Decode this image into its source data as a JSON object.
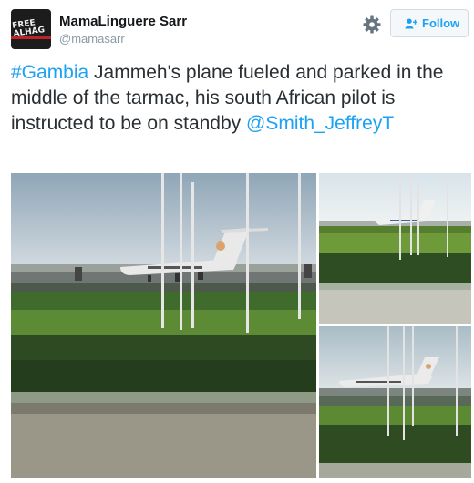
{
  "user": {
    "display_name": "MamaLinguere Sarr",
    "handle": "@mamasarr",
    "avatar_text_line1": "FREE",
    "avatar_text_line2": "ALHAG"
  },
  "actions": {
    "follow_label": "Follow",
    "settings_icon": "gear-icon",
    "follow_icon": "add-user-icon"
  },
  "tweet": {
    "hashtag": "#Gambia",
    "body": " Jammeh's plane fueled and parked in the middle of the tarmac, his south African pilot is instructed to be on standby ",
    "mention": "@Smith_JeffreyT"
  },
  "colors": {
    "link": "#1da1f2",
    "text": "#292f33",
    "muted": "#8899a6"
  }
}
